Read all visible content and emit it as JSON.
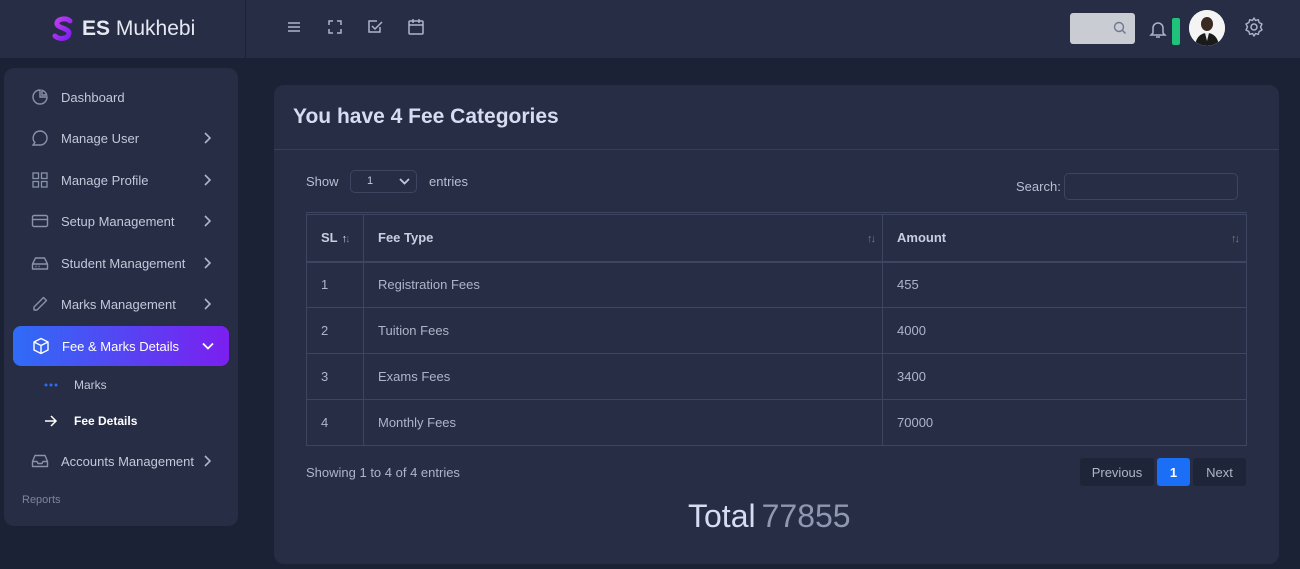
{
  "brand": {
    "bold": "ES",
    "rest": "Mukhebi"
  },
  "topbar": {
    "icons": [
      "menu-icon",
      "fullscreen-icon",
      "checkbox-icon",
      "calendar-icon"
    ],
    "search_icon": "search-icon",
    "bell_icon": "bell-icon",
    "settings_icon": "gear-icon"
  },
  "sidebar": {
    "items": [
      {
        "label": "Dashboard",
        "icon": "pie-chart-icon",
        "has_chevron": false
      },
      {
        "label": "Manage User",
        "icon": "chat-bubble-icon",
        "has_chevron": true
      },
      {
        "label": "Manage Profile",
        "icon": "grid-icon",
        "has_chevron": true
      },
      {
        "label": "Setup Management",
        "icon": "credit-card-icon",
        "has_chevron": true
      },
      {
        "label": "Student Management",
        "icon": "hard-drive-icon",
        "has_chevron": true
      },
      {
        "label": "Marks Management",
        "icon": "pencil-icon",
        "has_chevron": true
      },
      {
        "label": "Fee & Marks Details",
        "icon": "package-icon",
        "has_chevron": true,
        "active": true
      },
      {
        "label": "Accounts Management",
        "icon": "inbox-icon",
        "has_chevron": true
      }
    ],
    "subitems": [
      {
        "label": "Marks",
        "icon": "dots-icon"
      },
      {
        "label": "Fee Details",
        "icon": "arrow-right-icon",
        "active": true
      }
    ],
    "section_label": "Reports"
  },
  "main": {
    "title": "You have 4 Fee Categories",
    "show_label": "Show",
    "entries_value": "1",
    "entries_label": "entries",
    "search_label": "Search:",
    "columns": [
      "SL",
      "Fee Type",
      "Amount"
    ],
    "rows": [
      {
        "sl": "1",
        "fee_type": "Registration Fees",
        "amount": "455"
      },
      {
        "sl": "2",
        "fee_type": "Tuition Fees",
        "amount": "4000"
      },
      {
        "sl": "3",
        "fee_type": "Exams Fees",
        "amount": "3400"
      },
      {
        "sl": "4",
        "fee_type": "Monthly Fees",
        "amount": "70000"
      }
    ],
    "showing_text": "Showing 1 to 4 of 4 entries",
    "pagination": {
      "previous": "Previous",
      "current": "1",
      "next": "Next"
    },
    "total_label": "Total",
    "total_value": "77855"
  },
  "colors": {
    "background": "#1c2236",
    "panel": "#262d45",
    "accent_start": "#2f6cf6",
    "accent_end": "#7b1ff0",
    "page_active": "#1a6ff6",
    "notification": "#1ec27a"
  }
}
